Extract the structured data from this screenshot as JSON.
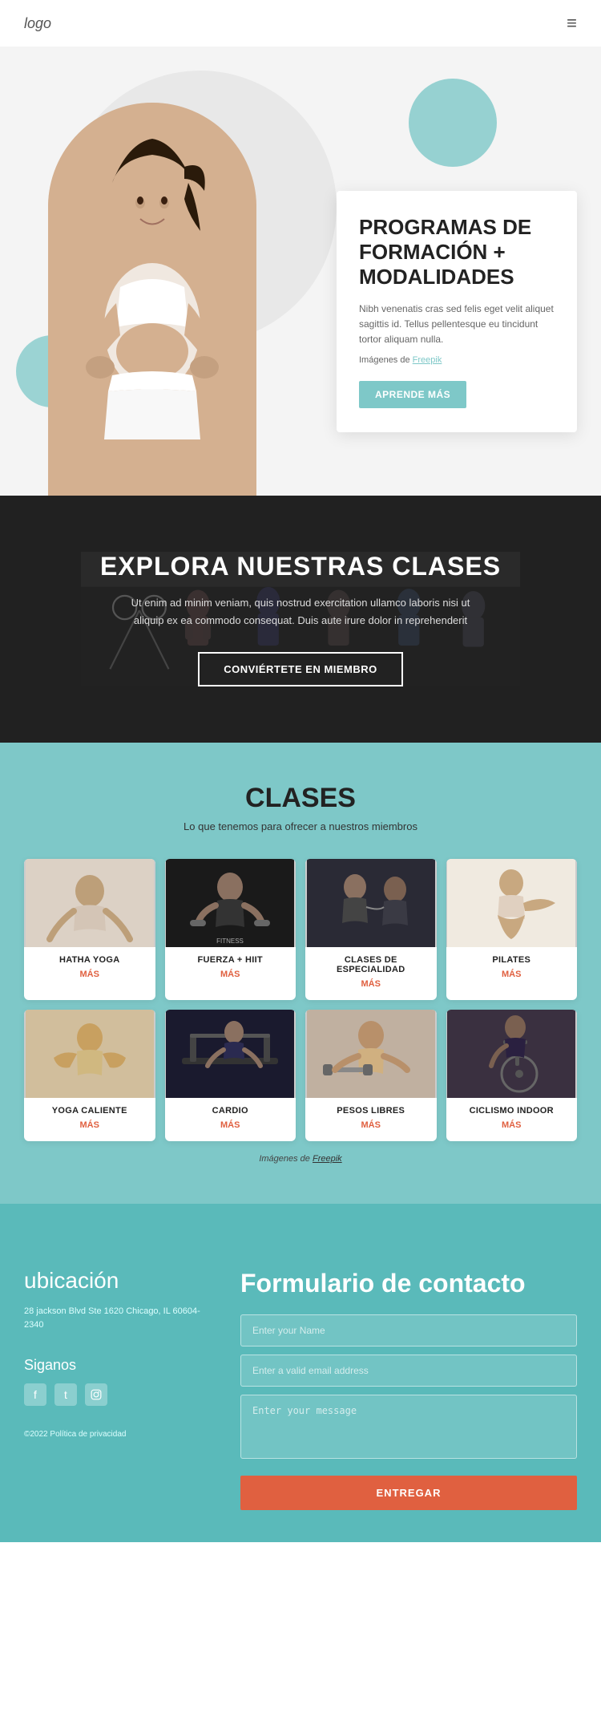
{
  "header": {
    "logo": "logo",
    "menu_icon": "≡"
  },
  "hero": {
    "title": "PROGRAMAS DE FORMACIÓN + MODALIDADES",
    "description": "Nibh venenatis cras sed felis eget velit aliquet sagittis id. Tellus pellentesque eu tincidunt tortor aliquam nulla.",
    "images_label": "Imágenes de",
    "images_link": "Freepik",
    "cta_button": "APRENDE MÁS"
  },
  "explore": {
    "title": "EXPLORA NUESTRAS CLASES",
    "description": "Ut enim ad minim veniam, quis nostrud exercitation ullamco laboris nisi ut aliquip ex ea commodo consequat. Duis aute irure dolor in reprehenderit",
    "cta_button": "CONVIÉRTETE EN MIEMBRO"
  },
  "classes": {
    "title": "CLASES",
    "subtitle": "Lo que tenemos para ofrecer a nuestros miembros",
    "items": [
      {
        "name": "HATHA YOGA",
        "more": "MÁS",
        "img_class": "img-yoga"
      },
      {
        "name": "FUERZA + HIIT",
        "more": "MÁS",
        "img_class": "img-strength"
      },
      {
        "name": "CLASES DE ESPECIALIDAD",
        "more": "MÁS",
        "img_class": "img-specialty"
      },
      {
        "name": "PILATES",
        "more": "MÁS",
        "img_class": "img-pilates"
      },
      {
        "name": "YOGA CALIENTE",
        "more": "MÁS",
        "img_class": "img-yoga-hot"
      },
      {
        "name": "CARDIO",
        "more": "MÁS",
        "img_class": "img-cardio"
      },
      {
        "name": "PESOS LIBRES",
        "more": "MÁS",
        "img_class": "img-weights"
      },
      {
        "name": "CICLISMO INDOOR",
        "more": "MÁS",
        "img_class": "img-cycling"
      }
    ],
    "freepik_text": "Imágenes de",
    "freepik_link": "Freepik"
  },
  "footer": {
    "location_title": "ubicación",
    "address": "28 jackson Blvd Ste 1620 Chicago, IL 60604-2340",
    "follow_title": "Siganos",
    "social": [
      "f",
      "t",
      "✦"
    ],
    "copyright": "©2022 Política de privacidad",
    "form_title": "Formulario de contacto",
    "name_placeholder": "Enter your Name",
    "email_placeholder": "Enter a valid email address",
    "message_placeholder": "Enter your message",
    "submit_label": "ENTREGAR"
  }
}
